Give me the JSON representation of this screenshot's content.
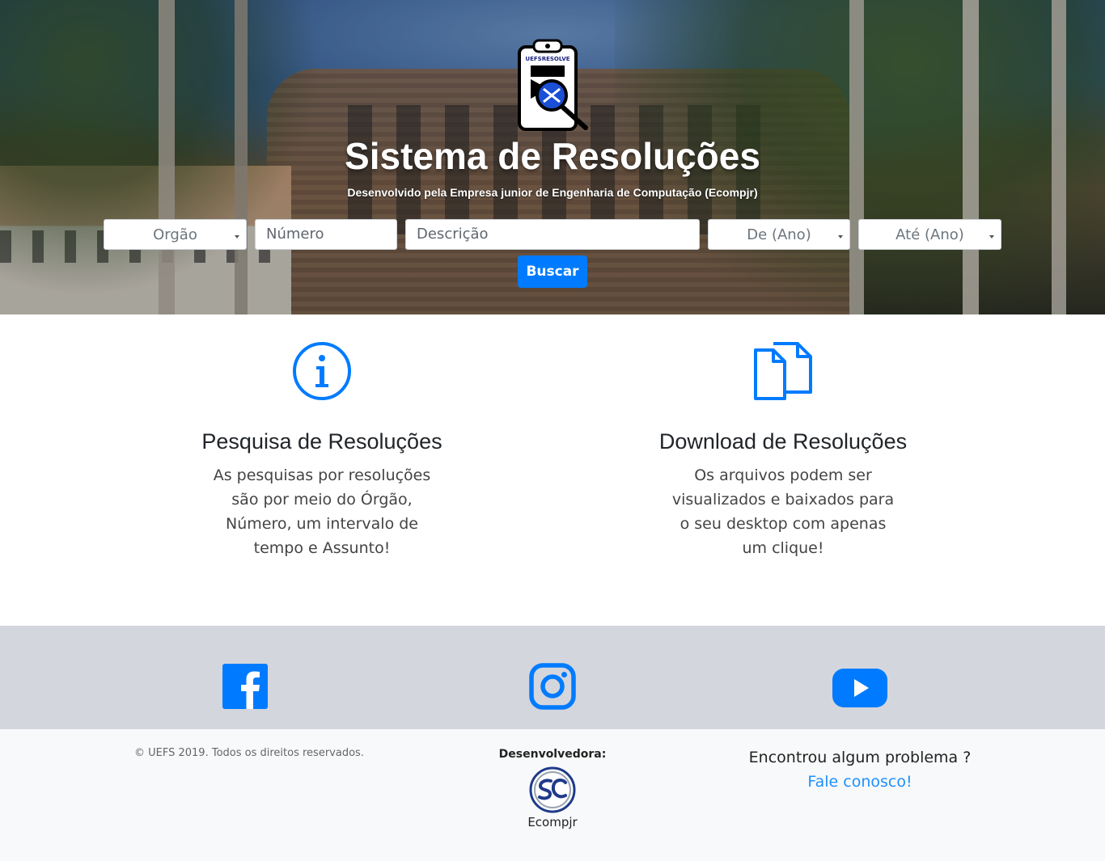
{
  "hero": {
    "title": "Sistema de Resoluções",
    "subtitle": "Desenvolvido pela Empresa junior de Engenharia de Computação (Ecompjr)",
    "logo_text": "UEFSRESOLVE"
  },
  "search": {
    "orgao": "Orgão",
    "numero_placeholder": "Número",
    "descricao_placeholder": "Descrição",
    "de_ano": "De (Ano)",
    "ate_ano": "Até (Ano)",
    "button": "Buscar"
  },
  "features": [
    {
      "icon": "info-icon",
      "title": "Pesquisa de Resoluções",
      "text": "As pesquisas por resoluções são por meio do Órgão, Número, um intervalo de tempo e Assunto!"
    },
    {
      "icon": "documents-icon",
      "title": "Download de Resoluções",
      "text": "Os arquivos podem ser visualizados e baixados para o seu desktop com apenas um clique!"
    }
  ],
  "social": {
    "icons": [
      "facebook-icon",
      "instagram-icon",
      "youtube-icon"
    ],
    "color": "#007bff"
  },
  "footer": {
    "copyright": "© UEFS 2019. Todos os direitos reservados.",
    "developer_label": "Desenvolvedora:",
    "developer_name": "Ecompjr",
    "problem": "Encontrou algum problema ?",
    "contact": "Fale conosco!"
  },
  "colors": {
    "primary": "#007bff",
    "social_bg": "#d4d6dd",
    "footer_bg": "#f8f9fa"
  }
}
